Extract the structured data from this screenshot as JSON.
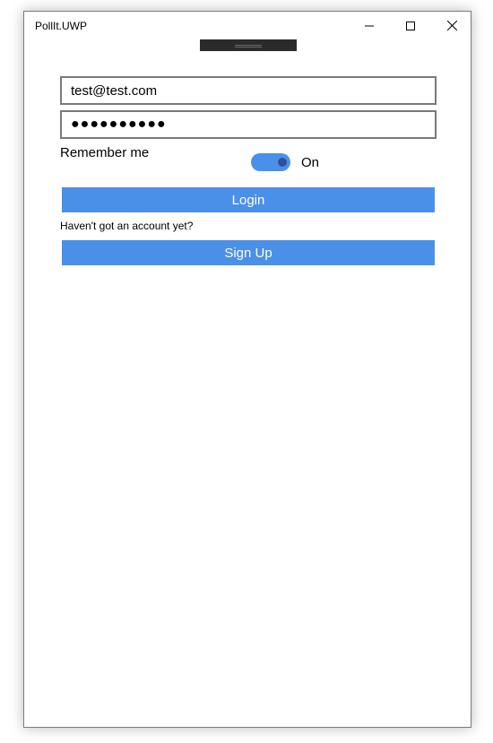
{
  "window": {
    "title": "PollIt.UWP"
  },
  "login": {
    "email_value": "test@test.com",
    "password_value": "●●●●●●●●●●",
    "remember_label": "Remember me",
    "toggle_state": "On",
    "login_label": "Login",
    "account_prompt": "Haven't got an account yet?",
    "signup_label": "Sign Up"
  },
  "colors": {
    "accent": "#4b90e8",
    "toggle_knob": "#2e4f99",
    "field_border": "#7a7a7a"
  },
  "icons": {
    "minimize": "minimize-icon",
    "maximize": "maximize-icon",
    "close": "close-icon"
  }
}
